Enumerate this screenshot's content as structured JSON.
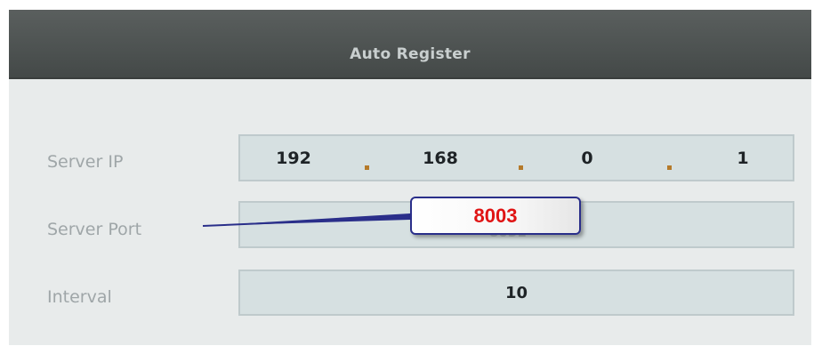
{
  "dialog": {
    "title": "Auto Register"
  },
  "fields": {
    "server_ip": {
      "label": "Server IP",
      "octets": [
        "192",
        "168",
        "0",
        "1"
      ]
    },
    "server_port": {
      "label": "Server Port",
      "value": "8003",
      "ghost_value": "8031"
    },
    "interval": {
      "label": "Interval",
      "value": "10"
    }
  },
  "annotation": {
    "callout_text": "8003",
    "callout_text_color": "#e01414",
    "callout_border_color": "#2a2f8a"
  }
}
